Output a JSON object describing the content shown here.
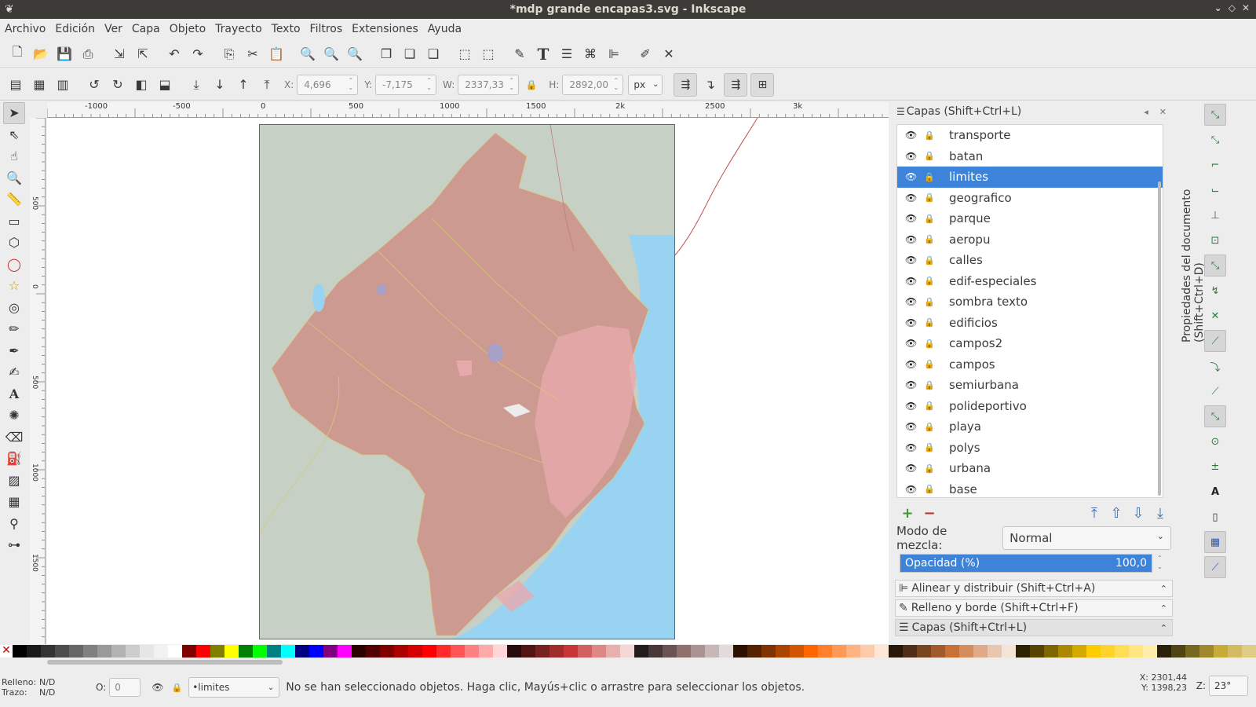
{
  "window": {
    "title": "*mdp grande encapas3.svg - Inkscape"
  },
  "menu": [
    "Archivo",
    "Edición",
    "Ver",
    "Capa",
    "Objeto",
    "Trayecto",
    "Texto",
    "Filtros",
    "Extensiones",
    "Ayuda"
  ],
  "controls": {
    "x_label": "X:",
    "x_value": "4,696",
    "y_label": "Y:",
    "y_value": "-7,175",
    "w_label": "W:",
    "w_value": "2337,33",
    "h_label": "H:",
    "h_value": "2892,00",
    "unit": "px"
  },
  "ruler_h": [
    "-1000",
    "-500",
    "0",
    "500",
    "1000",
    "1500",
    "2k",
    "2500",
    "3k"
  ],
  "ruler_v": [
    "500",
    "0",
    "500",
    "1000",
    "1500"
  ],
  "layers_panel": {
    "title": "Capas (Shift+Ctrl+L)",
    "layers": [
      "transporte",
      "batan",
      "limites",
      "geografico",
      "parque",
      "aeropu",
      "calles",
      "edif-especiales",
      "sombra texto",
      "edificios",
      "campos2",
      "campos",
      "semiurbana",
      "polideportivo",
      "playa",
      "polys",
      "urbana",
      "base"
    ],
    "selected": "limites",
    "blend_label": "Modo de mezcla:",
    "blend_value": "Normal",
    "opacity_label": "Opacidad (%)",
    "opacity_value": "100,0"
  },
  "docked_panels": [
    "Alinear y distribuir (Shift+Ctrl+A)",
    "Relleno y borde (Shift+Ctrl+F)",
    "Capas (Shift+Ctrl+L)"
  ],
  "doc_props_tab": "Propiedades del documento (Shift+Ctrl+D)",
  "status": {
    "fill_label": "Relleno:",
    "fill_value": "N/D",
    "stroke_label": "Trazo:",
    "stroke_value": "N/D",
    "opacity_label": "O:",
    "opacity_value": "0",
    "layer": "•limites",
    "message": "No se han seleccionado objetos. Haga clic, Mayús+clic o arrastre para seleccionar los objetos.",
    "x_coord": "X: 2301,44",
    "y_coord": "Y: 1398,23",
    "zoom_label": "Z:",
    "zoom_value": "23°"
  },
  "colors": {
    "selection": "#3c83d9",
    "map_land": "#c7d0c5",
    "map_region": "#cc9a90",
    "sea": "#99d3f2",
    "urban": "#e8a9ad"
  },
  "palette": [
    "#000000",
    "#1a1a1a",
    "#333333",
    "#4d4d4d",
    "#666666",
    "#808080",
    "#999999",
    "#b3b3b3",
    "#cccccc",
    "#e6e6e6",
    "#f2f2f2",
    "#ffffff",
    "#800000",
    "#ff0000",
    "#808000",
    "#ffff00",
    "#008000",
    "#00ff00",
    "#008080",
    "#00ffff",
    "#000080",
    "#0000ff",
    "#800080",
    "#ff00ff",
    "#2b0000",
    "#550000",
    "#800000",
    "#aa0000",
    "#d40000",
    "#ff0000",
    "#ff2a2a",
    "#ff5555",
    "#ff8080",
    "#ffaaaa",
    "#ffd5d5",
    "#280b0b",
    "#501616",
    "#782121",
    "#a02c2c",
    "#c83737",
    "#d35f5f",
    "#de8787",
    "#e9afaf",
    "#f4d7d7",
    "#241c1c",
    "#483737",
    "#6c5353",
    "#916f6f",
    "#ac9393",
    "#c8b7b7",
    "#e3dbdb",
    "#2b1100",
    "#552200",
    "#803300",
    "#aa4400",
    "#d45500",
    "#ff6600",
    "#ff7f2a",
    "#ff9955",
    "#ffb380",
    "#ffccaa",
    "#ffe6d5",
    "#28170b",
    "#502d16",
    "#784421",
    "#a05a2c",
    "#c87137",
    "#d38d5f",
    "#deaa87",
    "#e9c6af",
    "#f4e3d7",
    "#2b2200",
    "#554400",
    "#806600",
    "#aa8800",
    "#d4aa00",
    "#ffcc00",
    "#ffd42a",
    "#ffdd55",
    "#ffe680",
    "#ffeeaa",
    "#28220b",
    "#504416",
    "#786721",
    "#a0892c",
    "#c8ab37",
    "#d3bc5f",
    "#decd87"
  ]
}
